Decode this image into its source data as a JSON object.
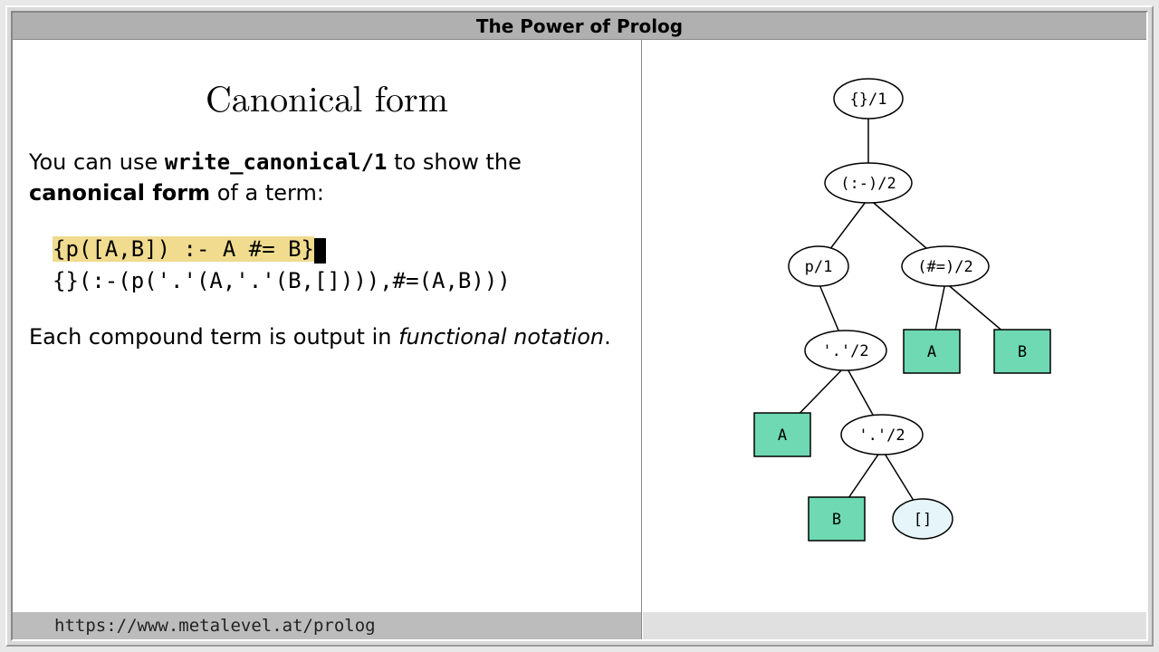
{
  "title": "The Power of Prolog",
  "heading": "Canonical form",
  "text": {
    "p1_a": "You can use ",
    "p1_predicate": "write_canonical/1",
    "p1_b": " to show the ",
    "p1_canon": "canonical form",
    "p1_c": " of a term:",
    "code_input": "{p([A,B]) :- A #= B}",
    "code_output": "{}(:-(p('.'(A,'.'(B,[]))),#=(A,B)))",
    "p2_a": "Each compound term is output in ",
    "p2_italic": "functional notation",
    "p2_c": "."
  },
  "footer_url": "https://www.metalevel.at/prolog",
  "tree": {
    "nodes": {
      "curly": {
        "label": "{}/1"
      },
      "rule": {
        "label": "(:-)/2"
      },
      "p": {
        "label": "p/1"
      },
      "hash": {
        "label": "(#=)/2"
      },
      "dot1": {
        "label": "'.'/2"
      },
      "A1": {
        "label": "A"
      },
      "B1": {
        "label": "B"
      },
      "A2": {
        "label": "A"
      },
      "dot2": {
        "label": "'.'/2"
      },
      "B2": {
        "label": "B"
      },
      "nil": {
        "label": "[]"
      }
    }
  }
}
